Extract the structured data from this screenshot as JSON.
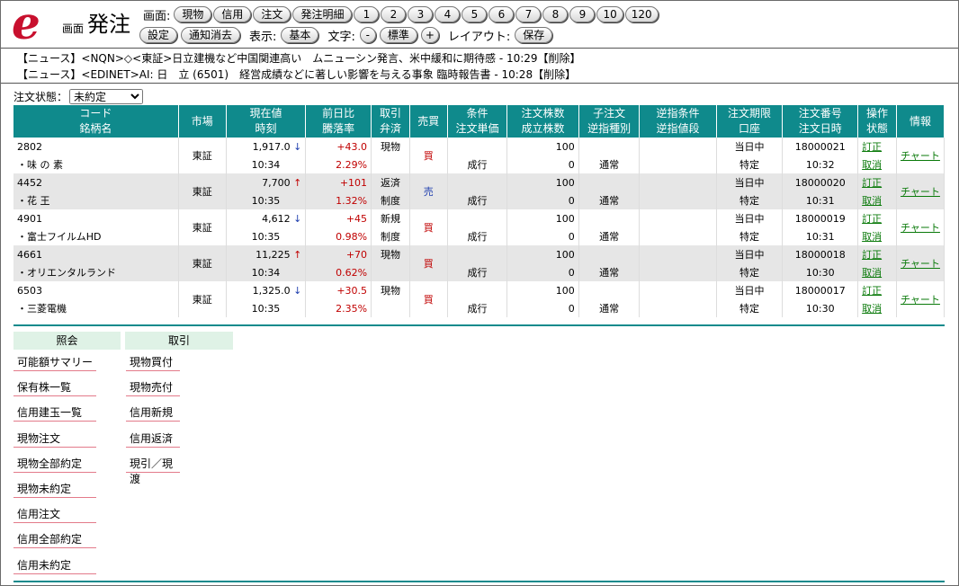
{
  "header": {
    "logo_sub": "画面",
    "logo_main": "発注",
    "screen_label": "画面:",
    "screen_buttons": [
      "現物",
      "信用",
      "注文",
      "発注明細",
      "1",
      "2",
      "3",
      "4",
      "5",
      "6",
      "7",
      "8",
      "9",
      "10",
      "120"
    ],
    "settings_label": "設定",
    "clear_notify_label": "通知消去",
    "display_label": "表示:",
    "display_value": "基本",
    "font_label": "文字:",
    "font_minus": "-",
    "font_value": "標準",
    "font_plus": "+",
    "layout_label": "レイアウト:",
    "layout_save": "保存"
  },
  "news": [
    "【ニュース】<NQN>◇<東証>日立建機など中国関連高い　ムニューシン発言、米中緩和に期待感 - 10:29【削除】",
    "【ニュース】<EDINET>AI: 日　立 (6501)　経営成績などに著しい影響を与える事象 臨時報告書 - 10:28【削除】"
  ],
  "status_filter": {
    "label": "注文状態：",
    "value": "未約定"
  },
  "table": {
    "headers": [
      [
        "コード",
        "銘柄名"
      ],
      [
        "市場"
      ],
      [
        "現在値",
        "時刻"
      ],
      [
        "前日比",
        "騰落率"
      ],
      [
        "取引",
        "弁済"
      ],
      [
        "売買"
      ],
      [
        "条件",
        "注文単価"
      ],
      [
        "注文株数",
        "成立株数"
      ],
      [
        "子注文",
        "逆指種別"
      ],
      [
        "逆指条件",
        "逆指値段"
      ],
      [
        "注文期限",
        "口座"
      ],
      [
        "注文番号",
        "注文日時"
      ],
      [
        "操作",
        "状態"
      ],
      [
        "情報"
      ]
    ],
    "rows": [
      {
        "code": "2802",
        "name": "・味 の 素",
        "market": "東証",
        "price": "1,917.0",
        "dir": "down",
        "time": "10:34",
        "change": "+43.0",
        "rate": "2.29%",
        "trade": "現物",
        "settle": "",
        "side": "買",
        "cond": "",
        "unit_price": "成行",
        "qty": "100",
        "filled": "0",
        "child": "",
        "stop_type": "通常",
        "stop_cond": "",
        "stop_price": "",
        "term": "当日中",
        "account": "特定",
        "order_no": "18000021",
        "order_time": "10:32",
        "edit": "訂正",
        "cancel": "取消",
        "info": "チャート"
      },
      {
        "code": "4452",
        "name": "・花 王",
        "market": "東証",
        "price": "7,700",
        "dir": "up",
        "time": "10:35",
        "change": "+101",
        "rate": "1.32%",
        "trade": "返済",
        "settle": "制度",
        "side": "売",
        "cond": "",
        "unit_price": "成行",
        "qty": "100",
        "filled": "0",
        "child": "",
        "stop_type": "通常",
        "stop_cond": "",
        "stop_price": "",
        "term": "当日中",
        "account": "特定",
        "order_no": "18000020",
        "order_time": "10:31",
        "edit": "訂正",
        "cancel": "取消",
        "info": "チャート"
      },
      {
        "code": "4901",
        "name": "・富士フイルムHD",
        "market": "東証",
        "price": "4,612",
        "dir": "down",
        "time": "10:35",
        "change": "+45",
        "rate": "0.98%",
        "trade": "新規",
        "settle": "制度",
        "side": "買",
        "cond": "",
        "unit_price": "成行",
        "qty": "100",
        "filled": "0",
        "child": "",
        "stop_type": "通常",
        "stop_cond": "",
        "stop_price": "",
        "term": "当日中",
        "account": "特定",
        "order_no": "18000019",
        "order_time": "10:31",
        "edit": "訂正",
        "cancel": "取消",
        "info": "チャート"
      },
      {
        "code": "4661",
        "name": "・オリエンタルランド",
        "market": "東証",
        "price": "11,225",
        "dir": "up",
        "time": "10:34",
        "change": "+70",
        "rate": "0.62%",
        "trade": "現物",
        "settle": "",
        "side": "買",
        "cond": "",
        "unit_price": "成行",
        "qty": "100",
        "filled": "0",
        "child": "",
        "stop_type": "通常",
        "stop_cond": "",
        "stop_price": "",
        "term": "当日中",
        "account": "特定",
        "order_no": "18000018",
        "order_time": "10:30",
        "edit": "訂正",
        "cancel": "取消",
        "info": "チャート"
      },
      {
        "code": "6503",
        "name": "・三菱電機",
        "market": "東証",
        "price": "1,325.0",
        "dir": "down",
        "time": "10:35",
        "change": "+30.5",
        "rate": "2.35%",
        "trade": "現物",
        "settle": "",
        "side": "買",
        "cond": "",
        "unit_price": "成行",
        "qty": "100",
        "filled": "0",
        "child": "",
        "stop_type": "通常",
        "stop_cond": "",
        "stop_price": "",
        "term": "当日中",
        "account": "特定",
        "order_no": "18000017",
        "order_time": "10:30",
        "edit": "訂正",
        "cancel": "取消",
        "info": "チャート"
      }
    ]
  },
  "menus": {
    "inquiry": {
      "title": "照会",
      "items": [
        "可能額サマリー",
        "保有株一覧",
        "信用建玉一覧",
        "現物注文",
        "現物全部約定",
        "現物未約定",
        "信用注文",
        "信用全部約定",
        "信用未約定"
      ]
    },
    "trade": {
      "title": "取引",
      "items": [
        "現物買付",
        "現物売付",
        "信用新規",
        "信用返済",
        "現引／現渡"
      ]
    }
  },
  "colors": {
    "header_teal": "#0f8a8c",
    "menu_head_bg": "#dff2e6",
    "menu_underline": "#e37a8a",
    "logo_red": "#c8102e",
    "link_green": "#0a7a0a"
  }
}
